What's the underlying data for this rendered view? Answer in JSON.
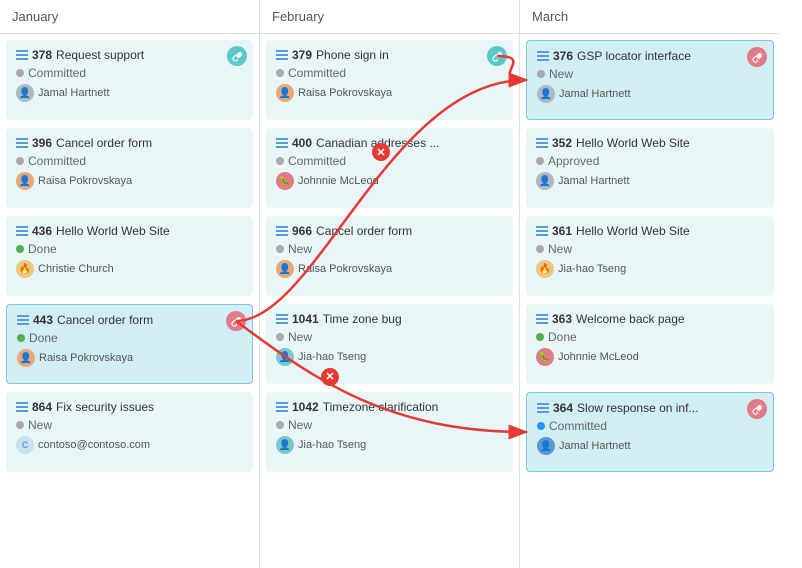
{
  "columns": [
    {
      "id": "january",
      "header": "January",
      "cards": [
        {
          "id": "378",
          "title": "Request support",
          "status": "Committed",
          "statusType": "committed",
          "user": "Jamal Hartnett",
          "avatarType": "gray",
          "avatarIcon": "👤",
          "hasLink": true,
          "linkColor": "teal-bg",
          "highlighted": false
        },
        {
          "id": "396",
          "title": "Cancel order form",
          "status": "Committed",
          "statusType": "committed",
          "user": "Raisa Pokrovskaya",
          "avatarType": "orange",
          "highlighted": false
        },
        {
          "id": "436",
          "title": "Hello World Web Site",
          "status": "Done",
          "statusType": "done",
          "user": "Christie Church",
          "avatarType": "yellow",
          "highlighted": false
        },
        {
          "id": "443",
          "title": "Cancel order form",
          "status": "Done",
          "statusType": "done-filled",
          "user": "Raisa Pokrovskaya",
          "avatarType": "orange",
          "hasLink": true,
          "linkColor": "pink",
          "highlighted": true
        },
        {
          "id": "864",
          "title": "Fix security issues",
          "status": "New",
          "statusType": "new",
          "user": "contoso@contoso.com",
          "avatarType": "contoso",
          "avatarText": "C",
          "highlighted": false
        }
      ]
    },
    {
      "id": "february",
      "header": "February",
      "cards": [
        {
          "id": "379",
          "title": "Phone sign in",
          "status": "Committed",
          "statusType": "committed",
          "user": "Raisa Pokrovskaya",
          "avatarType": "orange",
          "hasLink": true,
          "linkColor": "teal-bg",
          "highlighted": false
        },
        {
          "id": "400",
          "title": "Canadian addresses ...",
          "status": "Committed",
          "statusType": "committed",
          "user": "Johnnie McLeod",
          "avatarType": "pink",
          "highlighted": false
        },
        {
          "id": "966",
          "title": "Cancel order form",
          "status": "New",
          "statusType": "new",
          "user": "Raisa Pokrovskaya",
          "avatarType": "orange",
          "highlighted": false
        },
        {
          "id": "1041",
          "title": "Time zone bug",
          "status": "New",
          "statusType": "new",
          "user": "Jia-hao Tseng",
          "avatarType": "teal",
          "highlighted": false
        },
        {
          "id": "1042",
          "title": "Timezone clarification",
          "status": "New",
          "statusType": "new",
          "user": "Jia-hao Tseng",
          "avatarType": "teal",
          "highlighted": false
        }
      ]
    },
    {
      "id": "march",
      "header": "March",
      "cards": [
        {
          "id": "376",
          "title": "GSP locator interface",
          "status": "New",
          "statusType": "new",
          "user": "Jamal Hartnett",
          "avatarType": "gray",
          "hasLink": true,
          "linkColor": "pink",
          "highlighted": true
        },
        {
          "id": "352",
          "title": "Hello World Web Site",
          "status": "Approved",
          "statusType": "approved",
          "user": "Jamal Hartnett",
          "avatarType": "gray",
          "highlighted": false
        },
        {
          "id": "361",
          "title": "Hello World Web Site",
          "status": "New",
          "statusType": "new",
          "user": "Jia-hao Tseng",
          "avatarType": "yellow",
          "highlighted": false
        },
        {
          "id": "363",
          "title": "Welcome back page",
          "status": "Done",
          "statusType": "done",
          "user": "Johnnie McLeod",
          "avatarType": "pink",
          "highlighted": false
        },
        {
          "id": "364",
          "title": "Slow response on inf...",
          "status": "Committed",
          "statusType": "committed-blue",
          "user": "Jamal Hartnett",
          "avatarType": "blue",
          "hasLink": true,
          "linkColor": "pink",
          "highlighted": true
        }
      ]
    }
  ],
  "ui": {
    "close_icon": "✕",
    "link_icon": "🔗"
  }
}
